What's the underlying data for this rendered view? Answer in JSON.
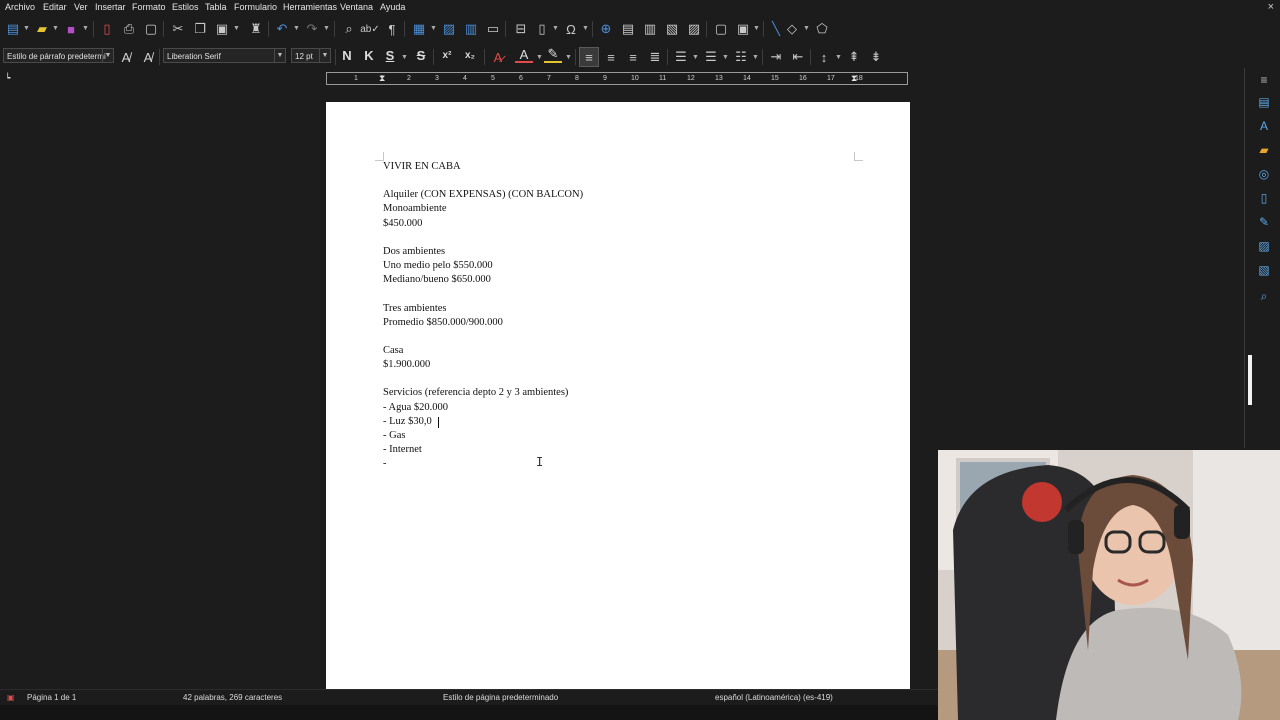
{
  "menu": {
    "items": [
      "Archivo",
      "Editar",
      "Ver",
      "Insertar",
      "Formato",
      "Estilos",
      "Tabla",
      "Formulario",
      "Herramientas",
      "Ventana",
      "Ayuda"
    ],
    "close_glyph": "×"
  },
  "format_bar": {
    "paragraph_style": "Estilo de párrafo predetermi",
    "font_name": "Liberation Serif",
    "font_size": "12 pt",
    "bold": "N",
    "italic": "K",
    "underline": "S",
    "strike": "S",
    "superscript": "x²",
    "subscript": "x₂"
  },
  "ruler": {
    "ticks": [
      "1",
      "1",
      "2",
      "3",
      "4",
      "5",
      "6",
      "7",
      "8",
      "9",
      "10",
      "11",
      "12",
      "13",
      "14",
      "15",
      "16",
      "17",
      "18"
    ]
  },
  "document": {
    "lines": [
      "VIVIR EN CABA",
      "",
      "Alquiler (CON EXPENSAS) (CON BALCON)",
      "Monoambiente",
      "$450.000",
      "",
      "Dos ambientes",
      "Uno medio pelo $550.000",
      "Mediano/bueno $650.000",
      "",
      "Tres ambientes",
      "Promedio $850.000/900.000",
      "",
      "Casa",
      "$1.900.000",
      "",
      "Servicios (referencia depto 2 y 3 ambientes)",
      "- Agua $20.000",
      "- Luz $30,0",
      "- Gas",
      "- Internet",
      "-"
    ]
  },
  "statusbar": {
    "page": "Página 1 de 1",
    "words": "42 palabras, 269 caracteres",
    "page_style": "Estilo de página predeterminado",
    "language": "español (Latinoamérica) (es-419)"
  },
  "colors": {
    "background": "#1c1c1c",
    "page": "#ffffff",
    "accent_blue": "#4a90d9",
    "font_color_red": "#e04b4b",
    "highlight_yellow": "#e5c52e"
  }
}
